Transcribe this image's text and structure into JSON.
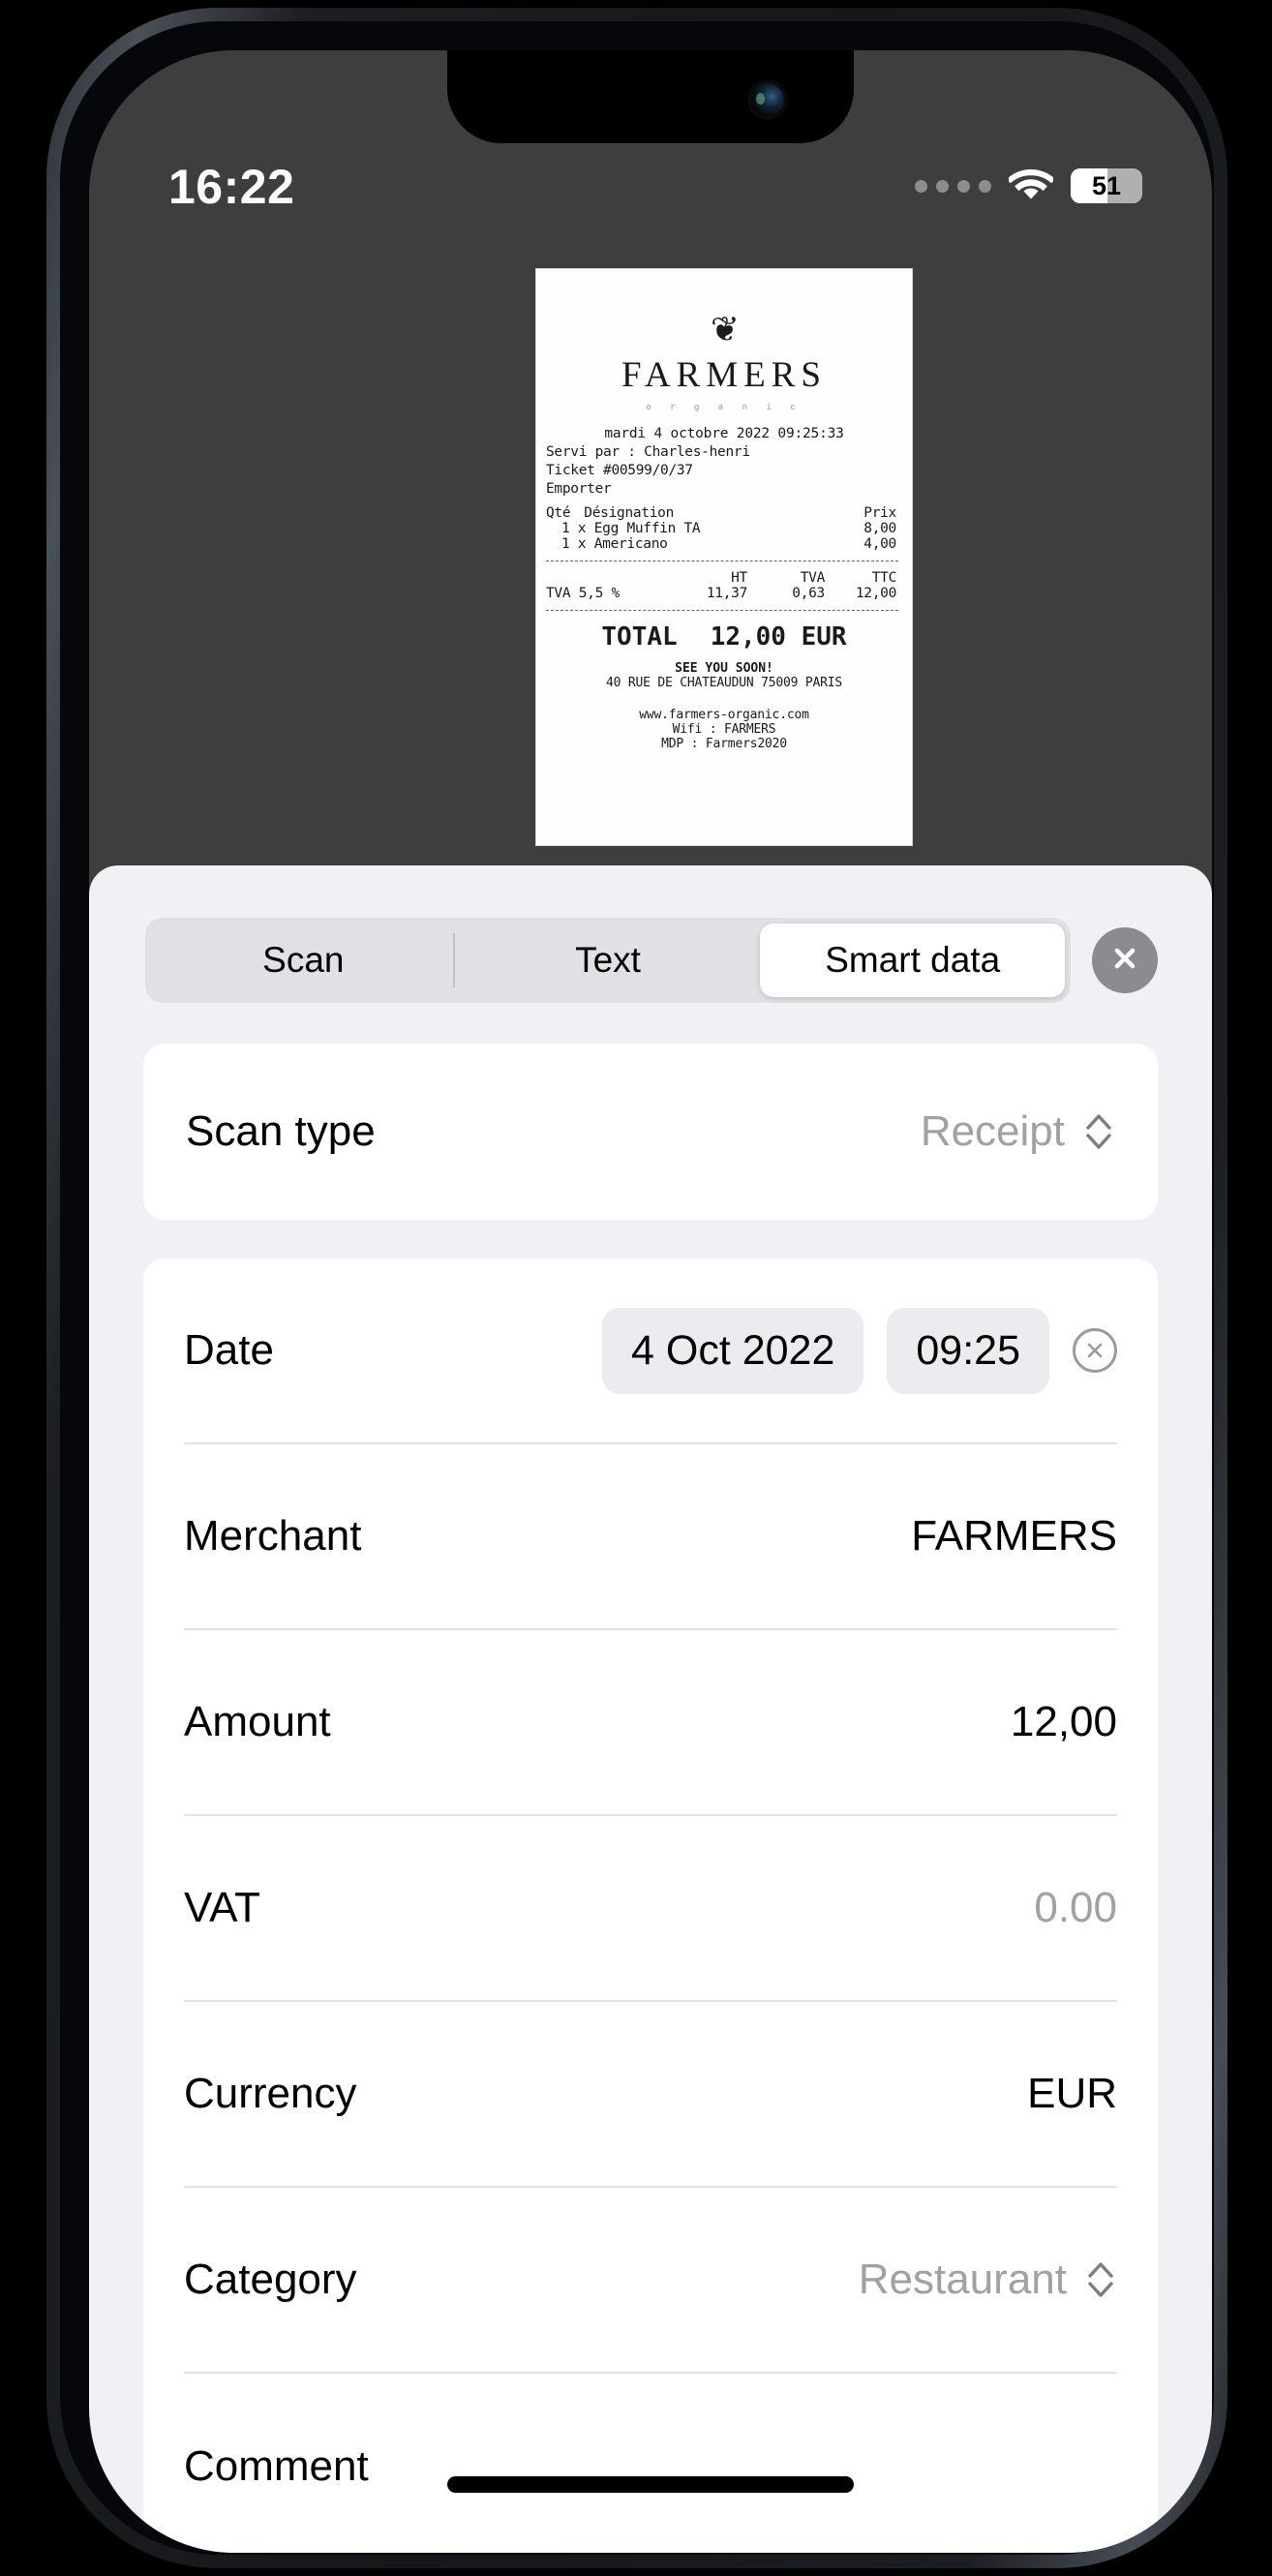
{
  "status_bar": {
    "time": "16:22",
    "cellular_icon": "cellular-dots-icon",
    "wifi_icon": "wifi-icon",
    "battery_level": "51",
    "battery_percent": 51
  },
  "receipt": {
    "logo_glyph": "❦",
    "brand": "FARMERS",
    "subtitle": "o r g a n i c",
    "datetime": "mardi 4 octobre 2022 09:25:33",
    "served_by": "Servi par : Charles-henri",
    "ticket": "Ticket #00599/0/37",
    "mode": "Emporter",
    "col_qty": "Qté",
    "col_designation": "Désignation",
    "col_price": "Prix",
    "items": [
      {
        "line": "1 x Egg Muffin TA",
        "price": "8,00"
      },
      {
        "line": "1 x Americano",
        "price": "4,00"
      }
    ],
    "tax_head": {
      "c1": "",
      "ht": "HT",
      "tva": "TVA",
      "ttc": "TTC"
    },
    "tax_row": {
      "label": "TVA 5,5 %",
      "ht": "11,37",
      "tva": "0,63",
      "ttc": "12,00"
    },
    "total_label": "TOTAL",
    "total_value": "12,00 EUR",
    "farewell": "SEE YOU SOON!",
    "address": "40 RUE DE CHATEAUDUN 75009 PARIS",
    "website": "www.farmers-organic.com",
    "wifi": "Wifi : FARMERS",
    "password": "MDP : Farmers2020"
  },
  "sheet": {
    "tabs": [
      {
        "label": "Scan",
        "selected": false
      },
      {
        "label": "Text",
        "selected": false
      },
      {
        "label": "Smart data",
        "selected": true
      }
    ],
    "close_icon": "close-icon",
    "scan_type": {
      "label": "Scan type",
      "value": "Receipt",
      "stepper_icon": "chevron-up-down-icon"
    },
    "fields": [
      {
        "name": "date",
        "label": "Date",
        "date_chip": "4 Oct 2022",
        "time_chip": "09:25",
        "clear_icon": "clear-circle-icon"
      },
      {
        "name": "merchant",
        "label": "Merchant",
        "value": "FARMERS",
        "muted": false
      },
      {
        "name": "amount",
        "label": "Amount",
        "value": "12,00",
        "muted": false
      },
      {
        "name": "vat",
        "label": "VAT",
        "value": "0.00",
        "muted": true
      },
      {
        "name": "currency",
        "label": "Currency",
        "value": "EUR",
        "muted": false
      },
      {
        "name": "category",
        "label": "Category",
        "value": "Restaurant",
        "muted": true,
        "stepper": true
      },
      {
        "name": "comment",
        "label": "Comment",
        "value": "",
        "muted": false
      }
    ]
  },
  "colors": {
    "sheet_background": "#f1f1f5",
    "card_background": "#ffffff",
    "segment_track": "#e0e0e5",
    "segment_selected": "#ffffff",
    "chip_background": "#ececf0",
    "muted_text": "#a0a0a5",
    "close_button": "#8b8b90",
    "backdrop": "#3e3e3e"
  }
}
